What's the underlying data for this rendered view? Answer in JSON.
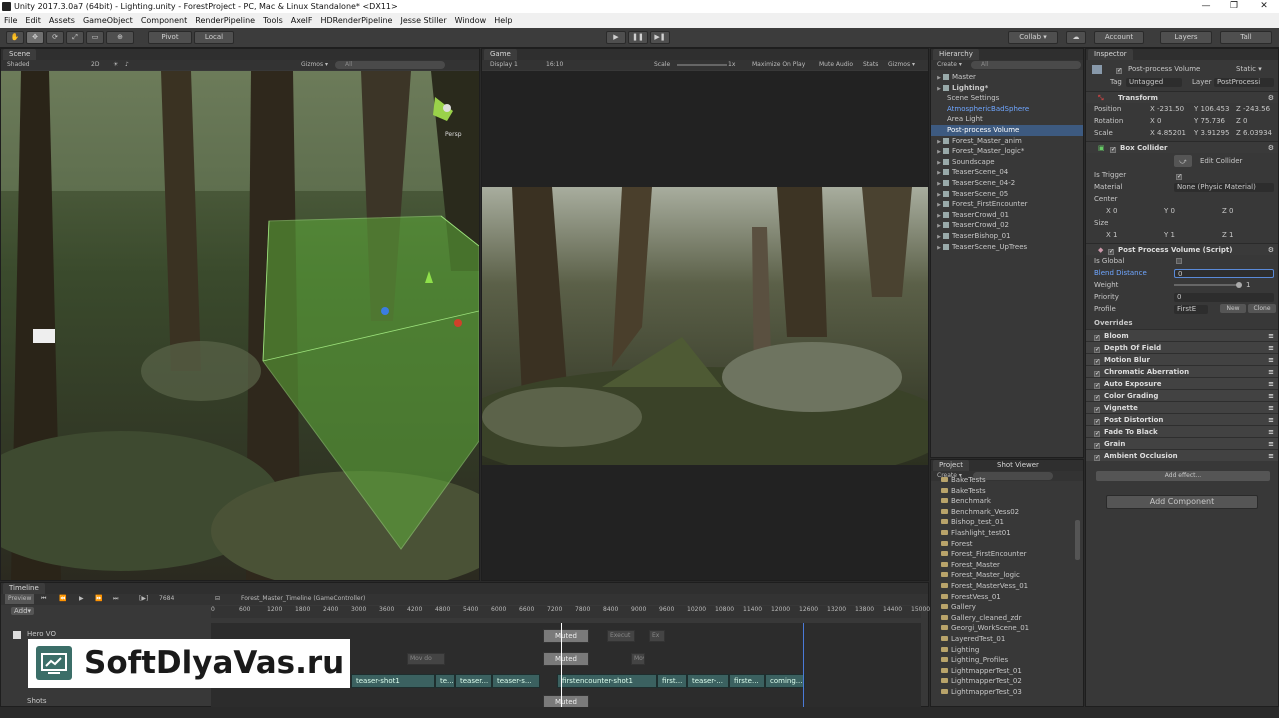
{
  "window": {
    "title": "Unity 2017.3.0a7 (64bit) - Lighting.unity - ForestProject - PC, Mac & Linux Standalone* <DX11>",
    "minimize": "—",
    "maximize": "❐",
    "close": "✕"
  },
  "menu": [
    "File",
    "Edit",
    "Assets",
    "GameObject",
    "Component",
    "RenderPipeline",
    "Tools",
    "AxelF",
    "HDRenderPipeline",
    "Jesse Stiller",
    "Window",
    "Help"
  ],
  "toolbar": {
    "pivot": "Pivot",
    "local": "Local",
    "collab": "Collab ▾",
    "account": "Account",
    "layers": "Layers",
    "layout": "Tall"
  },
  "scene": {
    "tab": "Scene",
    "shading": "Shaded",
    "mode2d": "2D",
    "gizmos": "Gizmos ▾",
    "search_placeholder": "All",
    "persp": "Persp"
  },
  "game": {
    "tab": "Game",
    "display": "Display 1",
    "aspect": "16:10",
    "scale_label": "Scale",
    "scale_value": "1x",
    "maximize": "Maximize On Play",
    "mute": "Mute Audio",
    "stats": "Stats",
    "gizmos": "Gizmos ▾"
  },
  "hierarchy": {
    "tab": "Hierarchy",
    "create": "Create ▾",
    "search_placeholder": "All",
    "items": [
      {
        "label": "Master",
        "indent": 0,
        "style": "normal"
      },
      {
        "label": "Lighting*",
        "indent": 0,
        "style": "bold"
      },
      {
        "label": "Scene Settings",
        "indent": 1,
        "style": "normal"
      },
      {
        "label": "AtmosphericBadSphere",
        "indent": 1,
        "style": "blue"
      },
      {
        "label": "Area Light",
        "indent": 1,
        "style": "normal"
      },
      {
        "label": "Post-process Volume",
        "indent": 1,
        "style": "selected"
      },
      {
        "label": "Forest_Master_anim",
        "indent": 0,
        "style": "normal"
      },
      {
        "label": "Forest_Master_logic*",
        "indent": 0,
        "style": "normal"
      },
      {
        "label": "Soundscape",
        "indent": 0,
        "style": "normal"
      },
      {
        "label": "TeaserScene_04",
        "indent": 0,
        "style": "normal"
      },
      {
        "label": "TeaserScene_04-2",
        "indent": 0,
        "style": "normal"
      },
      {
        "label": "TeaserScene_05",
        "indent": 0,
        "style": "normal"
      },
      {
        "label": "Forest_FirstEncounter",
        "indent": 0,
        "style": "normal"
      },
      {
        "label": "TeaserCrowd_01",
        "indent": 0,
        "style": "normal"
      },
      {
        "label": "TeaserCrowd_02",
        "indent": 0,
        "style": "normal"
      },
      {
        "label": "TeaserBishop_01",
        "indent": 0,
        "style": "normal"
      },
      {
        "label": "TeaserScene_UpTrees",
        "indent": 0,
        "style": "normal"
      }
    ]
  },
  "project": {
    "tab": "Project",
    "tab2": "Shot Viewer",
    "create": "Create ▾",
    "folders": [
      "BakeTests",
      "BakeTests",
      "Benchmark",
      "Benchmark_Vess02",
      "Bishop_test_01",
      "Flashlight_test01",
      "Forest",
      "Forest_FirstEncounter",
      "Forest_Master",
      "Forest_Master_logic",
      "Forest_MasterVess_01",
      "ForestVess_01",
      "Gallery",
      "Gallery_cleaned_zdr",
      "Georgi_WorkScene_01",
      "LayeredTest_01",
      "Lighting",
      "Lighting_Profiles",
      "LightmapperTest_01",
      "LightmapperTest_02",
      "LightmapperTest_03"
    ]
  },
  "inspector": {
    "tab": "Inspector",
    "object_name": "Post-process Volume",
    "static": "Static ▾",
    "tag_label": "Tag",
    "tag_value": "Untagged",
    "layer_label": "Layer",
    "layer_value": "PostProcessi",
    "transform": {
      "title": "Transform",
      "position_label": "Position",
      "pos": [
        "-231.50",
        "106.453",
        "-243.56"
      ],
      "rotation_label": "Rotation",
      "rot": [
        "0",
        "75.736",
        "0"
      ],
      "scale_label": "Scale",
      "scl": [
        "4.85201",
        "3.91295",
        "6.03934"
      ]
    },
    "box_collider": {
      "title": "Box Collider",
      "edit": "Edit Collider",
      "is_trigger": "Is Trigger",
      "material_label": "Material",
      "material_value": "None (Physic Material)",
      "center_label": "Center",
      "center": [
        "0",
        "0",
        "0"
      ],
      "size_label": "Size",
      "size": [
        "1",
        "1",
        "1"
      ]
    },
    "ppv": {
      "title": "Post Process Volume (Script)",
      "is_global": "Is Global",
      "blend_label": "Blend Distance",
      "blend_value": "0",
      "weight_label": "Weight",
      "weight_value": "1",
      "priority_label": "Priority",
      "priority_value": "0",
      "profile_label": "Profile",
      "profile_value": "FirstE",
      "new": "New",
      "clone": "Clone",
      "overrides_title": "Overrides",
      "overrides": [
        "Bloom",
        "Depth Of Field",
        "Motion Blur",
        "Chromatic Aberration",
        "Auto Exposure",
        "Color Grading",
        "Vignette",
        "Post Distortion",
        "Fade To Black",
        "Grain",
        "Ambient Occlusion"
      ],
      "add_effect": "Add effect..."
    },
    "add_component": "Add Component"
  },
  "timeline": {
    "tab": "Timeline",
    "preview": "Preview",
    "frame": "7684",
    "asset": "Forest_Master_Timeline (GameController)",
    "add": "Add▾",
    "ticks": [
      "0",
      "600",
      "1200",
      "1800",
      "2400",
      "3000",
      "3600",
      "4200",
      "4800",
      "5400",
      "6000",
      "6600",
      "7200",
      "7800",
      "8400",
      "9000",
      "9600",
      "10200",
      "10800",
      "11400",
      "12000",
      "12600",
      "13200",
      "13800",
      "14400",
      "15000"
    ],
    "tracks": [
      "Hero VO",
      "Shots"
    ],
    "muted": "Muted",
    "ghost_clips": [
      "Execut",
      "Mov do",
      "Ex",
      "Mov.."
    ],
    "shot_clips": [
      "teaser-shot1",
      "te...",
      "teaser...",
      "teaser-s...",
      "firstencounter-shot1",
      "first...",
      "teaser-...",
      "firste...",
      "coming..."
    ]
  },
  "watermark": "SoftDlyaVas.ru",
  "colors": {
    "accent": "#3d5a80",
    "clip": "#3b6160",
    "collider_green": "#5fae3a"
  }
}
